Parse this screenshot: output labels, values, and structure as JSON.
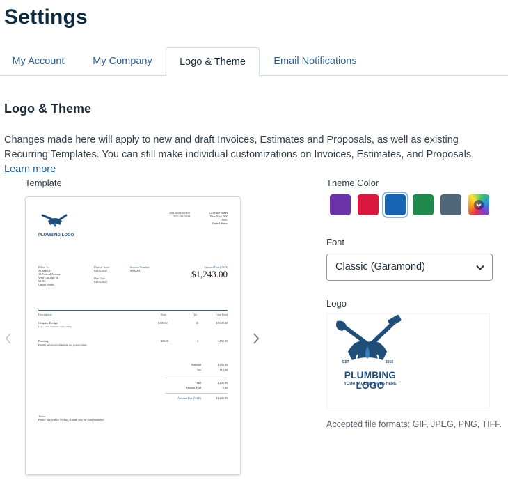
{
  "page": {
    "title": "Settings"
  },
  "tabs": [
    {
      "label": "My Account",
      "active": false
    },
    {
      "label": "My Company",
      "active": false
    },
    {
      "label": "Logo & Theme",
      "active": true
    },
    {
      "label": "Email Notifications",
      "active": false
    }
  ],
  "section": {
    "title": "Logo & Theme",
    "description": "Changes made here will apply to new and draft Invoices, Estimates and Proposals, as well as existing Recurring Templates. You can still make individual customizations on Invoices, Estimates, and Proposals.",
    "learn_more": "Learn more"
  },
  "template": {
    "label": "Template",
    "prev_icon": "chevron-left-icon",
    "next_icon": "chevron-right-icon",
    "invoice": {
      "logo_text": "PLUMBING LOGO",
      "company_name": "DELA DESIGNS",
      "company_phone": "555-456-3344",
      "company_address": [
        "123 Fake Street",
        "New York, NY",
        "10001",
        "United States"
      ],
      "billed_to_label": "Billed To",
      "billed_to": [
        "ACME CO",
        "15 Pretend Avenue",
        "West Chicago, IL",
        "60185",
        "United States"
      ],
      "date_label": "Date of Issue",
      "date_value": "02/03/2021",
      "due_label": "Due Date",
      "due_value": "03/03/2021",
      "invoice_number_label": "Invoice Number",
      "invoice_number_value": "0000001",
      "amount_due_label": "Amount Due (USD)",
      "amount_due_value": "$1,243.00",
      "columns": [
        "Description",
        "Rate",
        "Qty",
        "Line Total"
      ],
      "items": [
        {
          "name": "Graphic Design",
          "detail": "Logo, print, business cards, stamp",
          "rate": "$100.00",
          "qty": "10",
          "total": "$1,000.00"
        },
        {
          "name": "Printing",
          "detail": "Printing services for materials, and product labels",
          "rate": "$50.00",
          "qty": "3",
          "total": "$150.00"
        }
      ],
      "totals": [
        {
          "label": "Subtotal",
          "value": "1,150.00"
        },
        {
          "label": "Tax",
          "value": "114.00"
        },
        {
          "label": "Total",
          "value": "1,243.00"
        },
        {
          "label": "Amount Paid",
          "value": "0.00"
        }
      ],
      "amount_due_footer_label": "Amount Due (USD)",
      "amount_due_footer_value": "$1,243.00",
      "terms_label": "Terms",
      "terms_value": "Please pay within 30 days. Thank you for your business!"
    }
  },
  "theme": {
    "label": "Theme Color",
    "colors": [
      "#6a33a8",
      "#d9173f",
      "#1565b4",
      "#1f8a4c",
      "#4f6578",
      "custom"
    ],
    "selected_index": 2
  },
  "font": {
    "label": "Font",
    "value": "Classic (Garamond)"
  },
  "logo": {
    "label": "Logo",
    "title_text": "PLUMBING LOGO",
    "tagline": "YOUR TAGLINE GOES HERE",
    "est": "EST",
    "year": "2016",
    "formats": "Accepted file formats: GIF, JPEG, PNG, TIFF."
  }
}
